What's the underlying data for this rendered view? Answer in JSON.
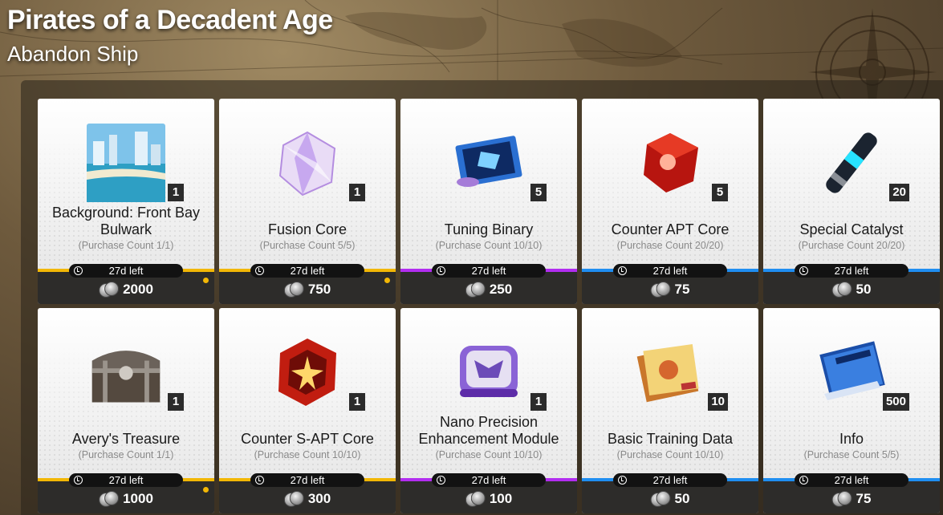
{
  "header": {
    "title": "Pirates of a Decadent Age",
    "subtitle": "Abandon Ship"
  },
  "colors": {
    "gold": "#f2b705",
    "purple": "#b22df0",
    "blue": "#1f8ef1",
    "card_bar": "#2d2c2a"
  },
  "items": [
    {
      "name": "Background: Front Bay Bulwark",
      "purchase_count": "(Purchase Count 1/1)",
      "quantity": "1",
      "time_left": "27d left",
      "price": "2000",
      "rarity": "gold",
      "notification": true,
      "icon": "background-image-icon"
    },
    {
      "name": "Fusion Core",
      "purchase_count": "(Purchase Count 5/5)",
      "quantity": "1",
      "time_left": "27d left",
      "price": "750",
      "rarity": "gold",
      "notification": true,
      "icon": "fusion-core-icon"
    },
    {
      "name": "Tuning Binary",
      "purchase_count": "(Purchase Count 10/10)",
      "quantity": "5",
      "time_left": "27d left",
      "price": "250",
      "rarity": "purple",
      "notification": false,
      "icon": "tuning-binary-icon"
    },
    {
      "name": "Counter APT Core",
      "purchase_count": "(Purchase Count 20/20)",
      "quantity": "5",
      "time_left": "27d left",
      "price": "75",
      "rarity": "blue",
      "notification": false,
      "icon": "apt-core-icon"
    },
    {
      "name": "Special Catalyst",
      "purchase_count": "(Purchase Count 20/20)",
      "quantity": "20",
      "time_left": "27d left",
      "price": "50",
      "rarity": "blue",
      "notification": false,
      "icon": "catalyst-icon"
    },
    {
      "name": "Avery's Treasure",
      "purchase_count": "(Purchase Count 1/1)",
      "quantity": "1",
      "time_left": "27d left",
      "price": "1000",
      "rarity": "gold",
      "notification": true,
      "icon": "treasure-chest-icon"
    },
    {
      "name": "Counter S-APT Core",
      "purchase_count": "(Purchase Count 10/10)",
      "quantity": "1",
      "time_left": "27d left",
      "price": "300",
      "rarity": "gold",
      "notification": false,
      "icon": "s-apt-core-icon"
    },
    {
      "name": "Nano Precision Enhancement Module",
      "purchase_count": "(Purchase Count 10/10)",
      "quantity": "1",
      "time_left": "27d left",
      "price": "100",
      "rarity": "purple",
      "notification": false,
      "icon": "nano-module-icon"
    },
    {
      "name": "Basic Training Data",
      "purchase_count": "(Purchase Count 10/10)",
      "quantity": "10",
      "time_left": "27d left",
      "price": "50",
      "rarity": "blue",
      "notification": false,
      "icon": "training-data-icon"
    },
    {
      "name": "Info",
      "purchase_count": "(Purchase Count 5/5)",
      "quantity": "500",
      "time_left": "27d left",
      "price": "75",
      "rarity": "blue",
      "notification": false,
      "icon": "info-book-icon"
    }
  ]
}
